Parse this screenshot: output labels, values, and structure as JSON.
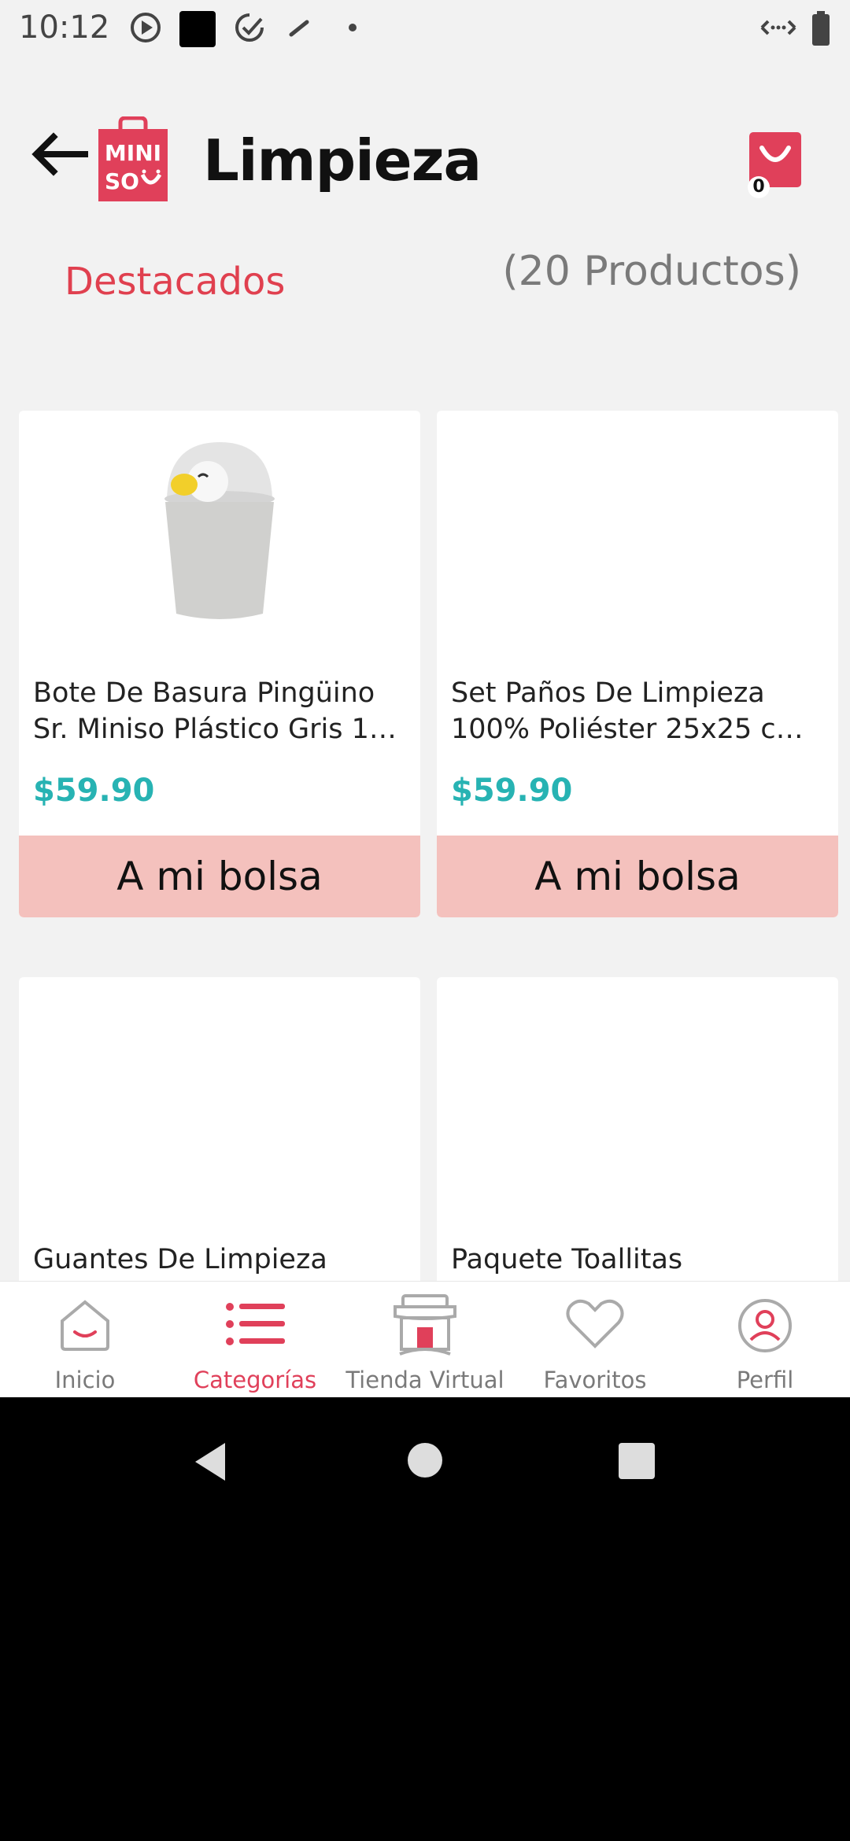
{
  "status_bar": {
    "time": "10:12"
  },
  "header": {
    "title": "Limpieza",
    "cart_count": "0"
  },
  "filter": {
    "sort_label": "Destacados",
    "product_count": "(20 Productos)"
  },
  "products": [
    {
      "name": "Bote De Basura Pingüino Sr. Miniso Plástico Gris 1…",
      "price": "$59.90",
      "button": "A mi bolsa"
    },
    {
      "name": "Set Paños De Limpieza 100% Poliéster 25x25 c…",
      "price": "$59.90",
      "button": "A mi bolsa"
    },
    {
      "name": "Guantes De Limpieza"
    },
    {
      "name": "Paquete Toallitas"
    }
  ],
  "logo_text": [
    "MINI",
    "SO"
  ],
  "bottom_nav": [
    {
      "label": "Inicio",
      "icon": "home-icon"
    },
    {
      "label": "Categorías",
      "icon": "categories-icon"
    },
    {
      "label": "Tienda Virtual",
      "icon": "store-icon"
    },
    {
      "label": "Favoritos",
      "icon": "heart-icon"
    },
    {
      "label": "Perfil",
      "icon": "profile-icon"
    }
  ],
  "colors": {
    "brand_red": "#e0405a",
    "price_teal": "#27b3b3",
    "button_pink": "#f4c1bd"
  }
}
